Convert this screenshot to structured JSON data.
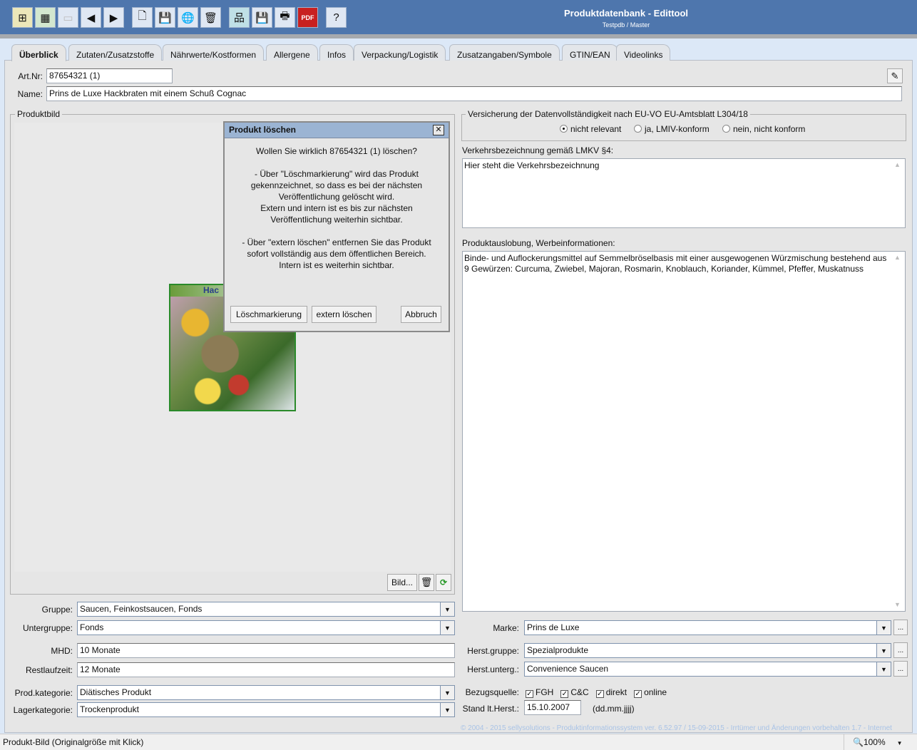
{
  "window": {
    "title": "Produktdatenbank - Edittool",
    "subtitle": "Testpdb / Master"
  },
  "toolbar": [
    {
      "icon": "search-list-icon"
    },
    {
      "icon": "table-icon"
    },
    {
      "icon": "folder-disabled-icon"
    },
    {
      "icon": "back-icon",
      "glyph": "◀"
    },
    {
      "icon": "forward-icon",
      "glyph": "▶"
    },
    {
      "icon": "new-document-icon",
      "glyph": "🗋"
    },
    {
      "icon": "save-icon",
      "glyph": "💾"
    },
    {
      "icon": "globe-icon",
      "glyph": "🌐"
    },
    {
      "icon": "trash-icon",
      "glyph": "🗑"
    },
    {
      "icon": "hierarchy-icon",
      "glyph": "品"
    },
    {
      "icon": "save-web-icon",
      "glyph": "💾"
    },
    {
      "icon": "print-icon",
      "glyph": "🖶"
    },
    {
      "icon": "pdf-export-icon",
      "glyph": "PDF"
    },
    {
      "icon": "help-icon",
      "glyph": "?"
    }
  ],
  "tabs": [
    "Überblick",
    "Zutaten/Zusatzstoffe",
    "Nährwerte/Kostformen",
    "Allergene",
    "Infos",
    "Verpackung/Logistik",
    "Zusatzangaben/Symbole",
    "GTIN/EAN",
    "Videolinks"
  ],
  "header": {
    "artnr_label": "Art.Nr:",
    "artnr_value": "87654321 (1)",
    "name_label": "Name:",
    "name_value": "Prins de Luxe Hackbraten mit einem Schuß Cognac"
  },
  "image_panel": {
    "title": "Produktbild",
    "image_text": "Hac",
    "bild_button": "Bild..."
  },
  "dialog": {
    "title": "Produkt löschen",
    "message": "Wollen Sie wirklich 87654321 (1) löschen?\n\n- Über \"Löschmarkierung\" wird das Produkt\ngekennzeichnet, so dass es bei der nächsten\nVeröffentlichung gelöscht wird.\nExtern und intern ist es bis zur nächsten\nVeröffentlichung weiterhin sichtbar.\n\n- Über \"extern löschen\" entfernen Sie das Produkt\nsofort vollständig aus dem öffentlichen Bereich.\nIntern ist es weiterhin sichtbar.",
    "buttons": [
      "Löschmarkierung",
      "extern löschen",
      "Abbruch"
    ]
  },
  "compliance": {
    "title": "Versicherung der Datenvollständigkeit nach EU-VO EU-Amtsblatt L304/18",
    "options": [
      "nicht relevant",
      "ja, LMIV-konform",
      "nein, nicht konform"
    ],
    "selected": 0
  },
  "verkehr": {
    "label": "Verkehrsbezeichnung gemäß LMKV §4:",
    "value": "Hier steht die Verkehrsbezeichnung"
  },
  "auslobung": {
    "label": "Produktauslobung, Werbeinformationen:",
    "value": "Binde- und Auflockerungsmittel auf Semmelbröselbasis mit einer ausgewogenen Würzmischung bestehend aus 9 Gewürzen: Curcuma, Zwiebel, Majoran, Rosmarin, Knoblauch, Koriander, Kümmel, Pfeffer, Muskatnuss"
  },
  "left_fields": {
    "gruppe": {
      "label": "Gruppe:",
      "value": "Saucen, Feinkostsaucen, Fonds"
    },
    "untergruppe": {
      "label": "Untergruppe:",
      "value": "Fonds"
    },
    "mhd": {
      "label": "MHD:",
      "value": "10 Monate"
    },
    "restlaufzeit": {
      "label": "Restlaufzeit:",
      "value": "12 Monate"
    },
    "prodkategorie": {
      "label": "Prod.kategorie:",
      "value": "Diätisches Produkt"
    },
    "lagerkategorie": {
      "label": "Lagerkategorie:",
      "value": "Trockenprodukt"
    }
  },
  "right_fields": {
    "marke": {
      "label": "Marke:",
      "value": "Prins de Luxe"
    },
    "herstgruppe": {
      "label": "Herst.gruppe:",
      "value": "Spezialprodukte"
    },
    "herstunterg": {
      "label": "Herst.unterg.:",
      "value": "Convenience Saucen"
    },
    "bezugsquelle": {
      "label": "Bezugsquelle:",
      "options": [
        {
          "label": "FGH",
          "checked": true
        },
        {
          "label": "C&C",
          "checked": true
        },
        {
          "label": "direkt",
          "checked": true
        },
        {
          "label": "online",
          "checked": true
        }
      ]
    },
    "stand": {
      "label": "Stand lt.Herst.:",
      "value": "15.10.2007",
      "hint": "(dd.mm.jjjj)"
    },
    "dots": "..."
  },
  "footer": {
    "copyright": "© 2004 - 2015 sellysolutions - Produktinformationssystem ver. 6.52.97 / 15-09-2015 - Irrtümer und Änderungen vorbehalten  1.7 - Internet"
  },
  "statusbar": {
    "text": "Produkt-Bild (Originalgröße mit Klick)",
    "zoom": "100%"
  }
}
